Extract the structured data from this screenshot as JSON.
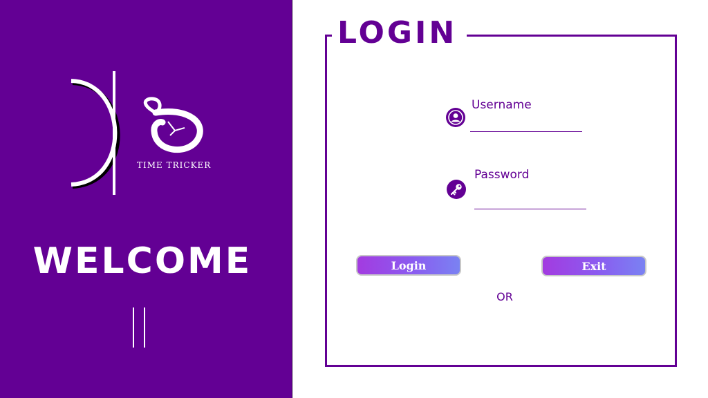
{
  "brand": {
    "name": "TIME TRICKER",
    "logo_icon": "clock-logo-icon"
  },
  "left_panel": {
    "welcome_text": "WELCOME",
    "background_color": "#630094"
  },
  "login": {
    "title": "LOGIN",
    "username": {
      "label": "Username",
      "icon": "user-icon",
      "value": "",
      "placeholder": ""
    },
    "password": {
      "label": "Password",
      "icon": "key-icon",
      "value": "",
      "placeholder": ""
    },
    "login_button": "Login",
    "exit_button": "Exit",
    "or_text": "OR"
  },
  "colors": {
    "accent": "#630094",
    "button_gradient_start": "#a33be0",
    "button_gradient_end": "#7a82f2"
  }
}
